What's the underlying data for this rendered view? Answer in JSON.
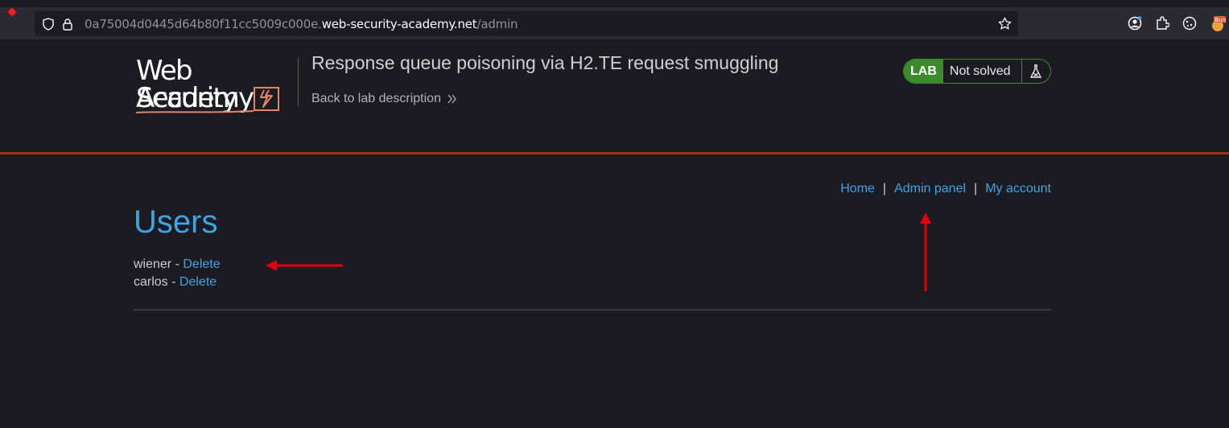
{
  "browser": {
    "url_prefix": "0a75004d0445d64b80f11cc5009c000e.",
    "url_host": "web-security-academy.net",
    "url_path": "/admin",
    "extension_label": "Burp"
  },
  "header": {
    "logo_line1": "Web Security",
    "logo_line2": "Academy",
    "lab_title": "Response queue poisoning via H2.TE request smuggling",
    "back_link": "Back to lab description",
    "badge_lab": "LAB",
    "badge_status": "Not solved"
  },
  "nav": {
    "home": "Home",
    "admin_panel": "Admin panel",
    "my_account": "My account",
    "separator": "|"
  },
  "main": {
    "title": "Users",
    "users": [
      {
        "name": "wiener",
        "separator": " - ",
        "action": "Delete"
      },
      {
        "name": "carlos",
        "separator": " - ",
        "action": "Delete"
      }
    ]
  },
  "colors": {
    "link": "#3fa4e4",
    "accent_border": "#a6330b",
    "lab_green": "#3d8a2c",
    "annotation_red": "#e0000f"
  }
}
